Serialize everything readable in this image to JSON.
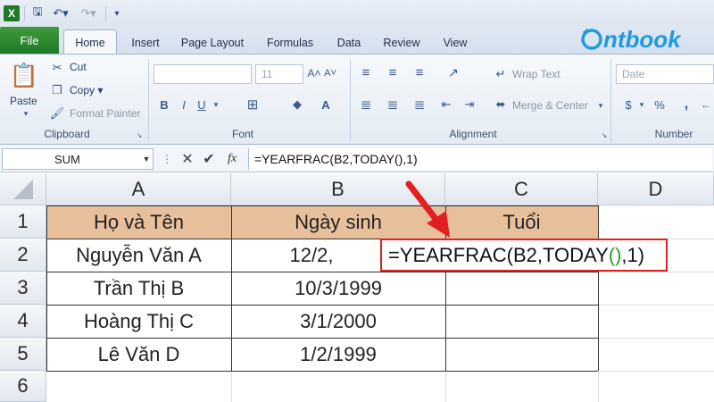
{
  "qat": {
    "icons": [
      "excel-icon",
      "save-icon",
      "undo-icon",
      "redo-icon",
      "customize-icon"
    ]
  },
  "tabs": {
    "file": "File",
    "home": "Home",
    "insert": "Insert",
    "page_layout": "Page Layout",
    "formulas": "Formulas",
    "data": "Data",
    "review": "Review",
    "view": "View"
  },
  "logo": "ntbook",
  "clipboard": {
    "paste": "Paste",
    "cut": "Cut",
    "copy": "Copy",
    "format_painter": "Format Painter",
    "label": "Clipboard"
  },
  "font": {
    "size": "11",
    "bold": "B",
    "italic": "I",
    "underline": "U",
    "label": "Font"
  },
  "alignment": {
    "wrap": "Wrap Text",
    "merge": "Merge & Center",
    "label": "Alignment"
  },
  "number": {
    "format": "Date",
    "currency": "$",
    "percent": "%",
    "label": "Number"
  },
  "formula_bar": {
    "name_box": "SUM",
    "formula": "=YEARFRAC(B2,TODAY(),1)",
    "fx": "fx"
  },
  "columns": [
    "A",
    "B",
    "C",
    "D"
  ],
  "rows": [
    "1",
    "2",
    "3",
    "4",
    "5",
    "6"
  ],
  "table": {
    "headers": [
      "Họ và Tên",
      "Ngày sinh",
      "Tuổi"
    ],
    "rows": [
      [
        "Nguyễn Văn A",
        "12/2,"
      ],
      [
        "Trần Thị B",
        "10/3/1999"
      ],
      [
        "Hoàng Thị C",
        "3/1/2000"
      ],
      [
        "Lê Văn D",
        "1/2/1999"
      ]
    ]
  },
  "edit_formula": {
    "prefix": "=YEARFRAC(B2,TODAY",
    "paren": "()",
    "suffix": ",1)"
  },
  "colors": {
    "header_fill": "#e8bf9b",
    "highlight_border": "#e02020",
    "arrow": "#e02020",
    "file_tab": "#2a8a2f"
  }
}
